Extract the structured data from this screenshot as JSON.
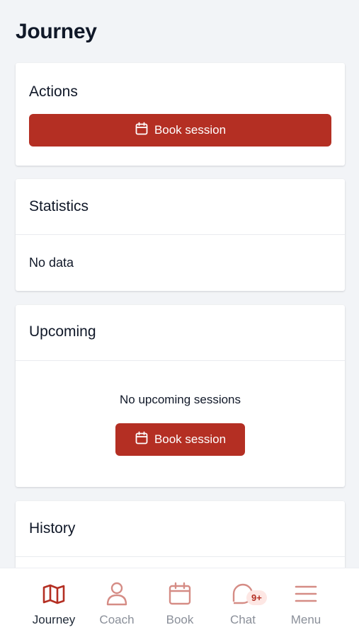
{
  "page": {
    "title": "Journey"
  },
  "actions": {
    "title": "Actions",
    "book_label": "Book session"
  },
  "statistics": {
    "title": "Statistics",
    "empty_text": "No data"
  },
  "upcoming": {
    "title": "Upcoming",
    "empty_text": "No upcoming sessions",
    "book_label": "Book session"
  },
  "history": {
    "title": "History"
  },
  "nav": {
    "items": [
      {
        "label": "Journey",
        "icon": "map-icon",
        "active": true
      },
      {
        "label": "Coach",
        "icon": "person-icon"
      },
      {
        "label": "Book",
        "icon": "calendar-icon"
      },
      {
        "label": "Chat",
        "icon": "chat-icon",
        "badge": "9+"
      },
      {
        "label": "Menu",
        "icon": "hamburger-menu-icon"
      }
    ]
  },
  "colors": {
    "accent": "#b42f23",
    "accent_light": "#d58c85",
    "background": "#f2f4f7",
    "badge_bg": "#fde7e4"
  }
}
